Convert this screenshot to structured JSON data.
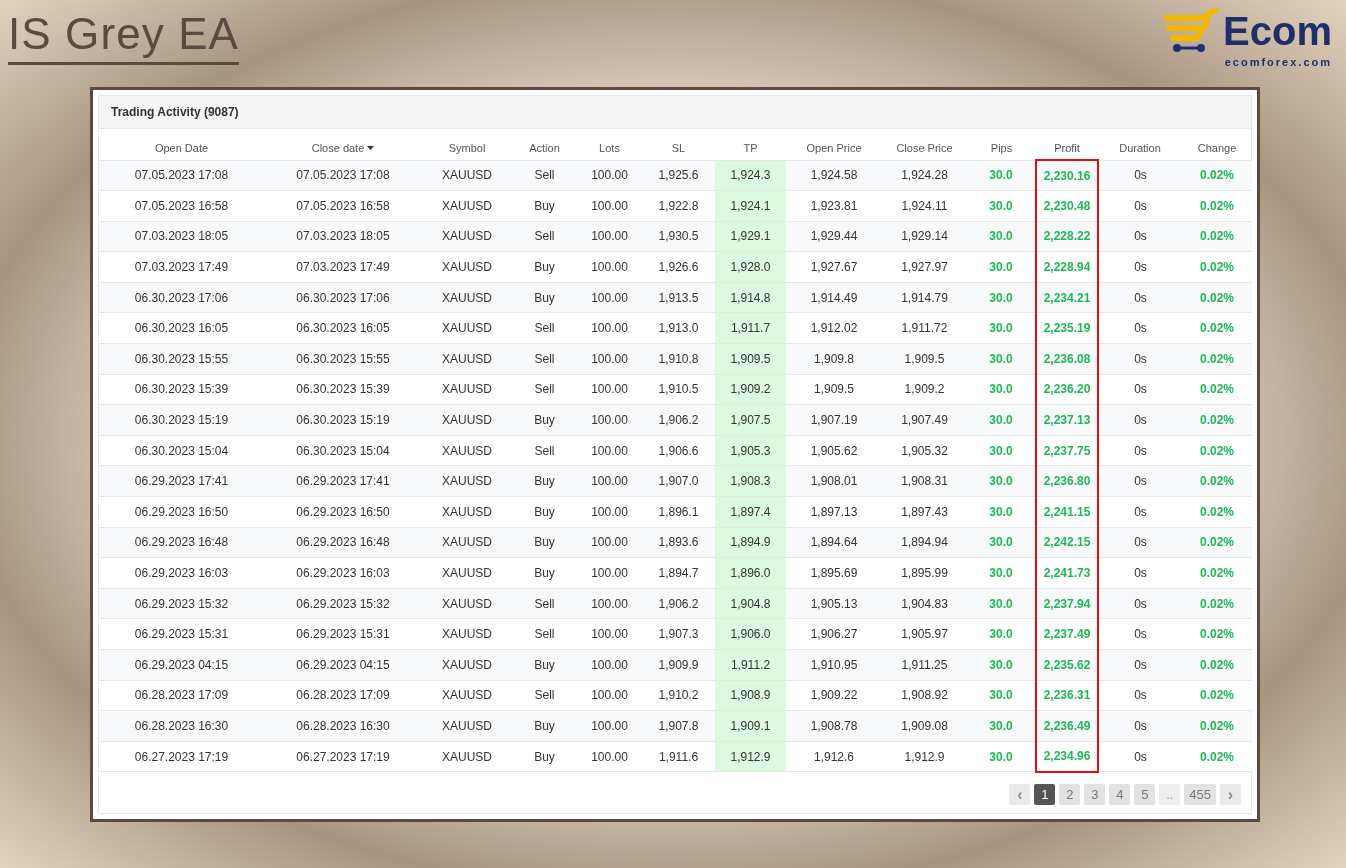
{
  "headline": "IS Grey EA",
  "logo": {
    "wordmark": "Ecom",
    "domain": "ecomforex.com"
  },
  "panel": {
    "title": "Trading Activity (9087)"
  },
  "table": {
    "columns": [
      {
        "label": "Open Date",
        "sorted": false,
        "kind": "plain"
      },
      {
        "label": "Close date",
        "sorted": true,
        "kind": "plain"
      },
      {
        "label": "Symbol",
        "sorted": false,
        "kind": "plain"
      },
      {
        "label": "Action",
        "sorted": false,
        "kind": "plain"
      },
      {
        "label": "Lots",
        "sorted": false,
        "kind": "plain"
      },
      {
        "label": "SL",
        "sorted": false,
        "kind": "plain"
      },
      {
        "label": "TP",
        "sorted": false,
        "kind": "target"
      },
      {
        "label": "Open Price",
        "sorted": false,
        "kind": "plain"
      },
      {
        "label": "Close Price",
        "sorted": false,
        "kind": "plain"
      },
      {
        "label": "Pips",
        "sorted": false,
        "kind": "gain"
      },
      {
        "label": "Profit",
        "sorted": false,
        "kind": "boxed"
      },
      {
        "label": "Duration",
        "sorted": false,
        "kind": "plain"
      },
      {
        "label": "Change",
        "sorted": false,
        "kind": "gain"
      }
    ],
    "rows": [
      [
        "07.05.2023 17:08",
        "07.05.2023 17:08",
        "XAUUSD",
        "Sell",
        "100.00",
        "1,925.6",
        "1,924.3",
        "1,924.58",
        "1,924.28",
        "30.0",
        "2,230.16",
        "0s",
        "0.02%"
      ],
      [
        "07.05.2023 16:58",
        "07.05.2023 16:58",
        "XAUUSD",
        "Buy",
        "100.00",
        "1,922.8",
        "1,924.1",
        "1,923.81",
        "1,924.11",
        "30.0",
        "2,230.48",
        "0s",
        "0.02%"
      ],
      [
        "07.03.2023 18:05",
        "07.03.2023 18:05",
        "XAUUSD",
        "Sell",
        "100.00",
        "1,930.5",
        "1,929.1",
        "1,929.44",
        "1,929.14",
        "30.0",
        "2,228.22",
        "0s",
        "0.02%"
      ],
      [
        "07.03.2023 17:49",
        "07.03.2023 17:49",
        "XAUUSD",
        "Buy",
        "100.00",
        "1,926.6",
        "1,928.0",
        "1,927.67",
        "1,927.97",
        "30.0",
        "2,228.94",
        "0s",
        "0.02%"
      ],
      [
        "06.30.2023 17:06",
        "06.30.2023 17:06",
        "XAUUSD",
        "Buy",
        "100.00",
        "1,913.5",
        "1,914.8",
        "1,914.49",
        "1,914.79",
        "30.0",
        "2,234.21",
        "0s",
        "0.02%"
      ],
      [
        "06.30.2023 16:05",
        "06.30.2023 16:05",
        "XAUUSD",
        "Sell",
        "100.00",
        "1,913.0",
        "1,911.7",
        "1,912.02",
        "1,911.72",
        "30.0",
        "2,235.19",
        "0s",
        "0.02%"
      ],
      [
        "06.30.2023 15:55",
        "06.30.2023 15:55",
        "XAUUSD",
        "Sell",
        "100.00",
        "1,910.8",
        "1,909.5",
        "1,909.8",
        "1,909.5",
        "30.0",
        "2,236.08",
        "0s",
        "0.02%"
      ],
      [
        "06.30.2023 15:39",
        "06.30.2023 15:39",
        "XAUUSD",
        "Sell",
        "100.00",
        "1,910.5",
        "1,909.2",
        "1,909.5",
        "1,909.2",
        "30.0",
        "2,236.20",
        "0s",
        "0.02%"
      ],
      [
        "06.30.2023 15:19",
        "06.30.2023 15:19",
        "XAUUSD",
        "Buy",
        "100.00",
        "1,906.2",
        "1,907.5",
        "1,907.19",
        "1,907.49",
        "30.0",
        "2,237.13",
        "0s",
        "0.02%"
      ],
      [
        "06.30.2023 15:04",
        "06.30.2023 15:04",
        "XAUUSD",
        "Sell",
        "100.00",
        "1,906.6",
        "1,905.3",
        "1,905.62",
        "1,905.32",
        "30.0",
        "2,237.75",
        "0s",
        "0.02%"
      ],
      [
        "06.29.2023 17:41",
        "06.29.2023 17:41",
        "XAUUSD",
        "Buy",
        "100.00",
        "1,907.0",
        "1,908.3",
        "1,908.01",
        "1,908.31",
        "30.0",
        "2,236.80",
        "0s",
        "0.02%"
      ],
      [
        "06.29.2023 16:50",
        "06.29.2023 16:50",
        "XAUUSD",
        "Buy",
        "100.00",
        "1,896.1",
        "1,897.4",
        "1,897.13",
        "1,897.43",
        "30.0",
        "2,241.15",
        "0s",
        "0.02%"
      ],
      [
        "06.29.2023 16:48",
        "06.29.2023 16:48",
        "XAUUSD",
        "Buy",
        "100.00",
        "1,893.6",
        "1,894.9",
        "1,894.64",
        "1,894.94",
        "30.0",
        "2,242.15",
        "0s",
        "0.02%"
      ],
      [
        "06.29.2023 16:03",
        "06.29.2023 16:03",
        "XAUUSD",
        "Buy",
        "100.00",
        "1,894.7",
        "1,896.0",
        "1,895.69",
        "1,895.99",
        "30.0",
        "2,241.73",
        "0s",
        "0.02%"
      ],
      [
        "06.29.2023 15:32",
        "06.29.2023 15:32",
        "XAUUSD",
        "Sell",
        "100.00",
        "1,906.2",
        "1,904.8",
        "1,905.13",
        "1,904.83",
        "30.0",
        "2,237.94",
        "0s",
        "0.02%"
      ],
      [
        "06.29.2023 15:31",
        "06.29.2023 15:31",
        "XAUUSD",
        "Sell",
        "100.00",
        "1,907.3",
        "1,906.0",
        "1,906.27",
        "1,905.97",
        "30.0",
        "2,237.49",
        "0s",
        "0.02%"
      ],
      [
        "06.29.2023 04:15",
        "06.29.2023 04:15",
        "XAUUSD",
        "Buy",
        "100.00",
        "1,909.9",
        "1,911.2",
        "1,910.95",
        "1,911.25",
        "30.0",
        "2,235.62",
        "0s",
        "0.02%"
      ],
      [
        "06.28.2023 17:09",
        "06.28.2023 17:09",
        "XAUUSD",
        "Sell",
        "100.00",
        "1,910.2",
        "1,908.9",
        "1,909.22",
        "1,908.92",
        "30.0",
        "2,236.31",
        "0s",
        "0.02%"
      ],
      [
        "06.28.2023 16:30",
        "06.28.2023 16:30",
        "XAUUSD",
        "Buy",
        "100.00",
        "1,907.8",
        "1,909.1",
        "1,908.78",
        "1,909.08",
        "30.0",
        "2,236.49",
        "0s",
        "0.02%"
      ],
      [
        "06.27.2023 17:19",
        "06.27.2023 17:19",
        "XAUUSD",
        "Buy",
        "100.00",
        "1,911.6",
        "1,912.9",
        "1,912.6",
        "1,912.9",
        "30.0",
        "2,234.96",
        "0s",
        "0.02%"
      ]
    ]
  },
  "pagination": [
    {
      "kind": "prev",
      "label": "‹",
      "selected": false
    },
    {
      "kind": "page",
      "label": "1",
      "selected": true
    },
    {
      "kind": "page",
      "label": "2",
      "selected": false
    },
    {
      "kind": "page",
      "label": "3",
      "selected": false
    },
    {
      "kind": "page",
      "label": "4",
      "selected": false
    },
    {
      "kind": "page",
      "label": "5",
      "selected": false
    },
    {
      "kind": "gap",
      "label": "..",
      "selected": false
    },
    {
      "kind": "page",
      "label": "455",
      "selected": false
    },
    {
      "kind": "next",
      "label": "›",
      "selected": false
    }
  ]
}
